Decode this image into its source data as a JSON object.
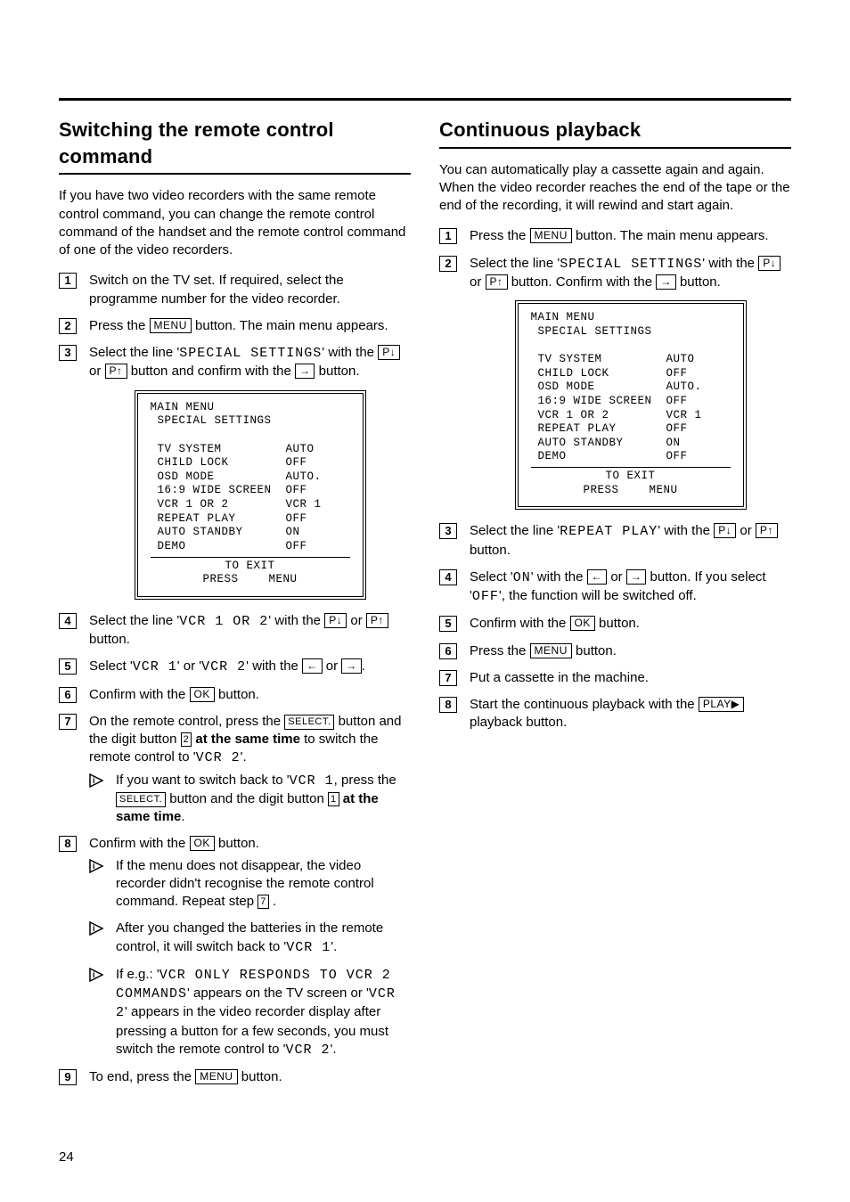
{
  "page_number": "24",
  "left": {
    "title": "Switching the remote control command",
    "intro": "If you have two video recorders with the same remote control command, you can change the remote control command of the handset and the remote control command of one of the video recorders.",
    "steps": {
      "s1": "Switch on the TV set. If required, select the programme number for the video recorder.",
      "s2a": "Press the ",
      "s2b": " button. The main menu appears.",
      "s3a": "Select the line '",
      "s3b": "' with the ",
      "s3c": " or ",
      "s3d": " button and confirm with the ",
      "s3e": " button.",
      "s4a": "Select the line '",
      "s4b": "' with the ",
      "s4c": " or ",
      "s4d": " button.",
      "s5a": "Select '",
      "s5b": "' or '",
      "s5c": "' with the ",
      "s5d": " or ",
      "s5e": ".",
      "s6a": "Confirm with the ",
      "s6b": " button.",
      "s7a": "On the remote control, press the ",
      "s7b": " button and the digit button ",
      "s7c": " at the same time",
      "s7d": " to switch the remote control to '",
      "s7e": "'.",
      "s7_tip1a": "If you want to switch back to '",
      "s7_tip1b": ", press the ",
      "s7_tip1c": " button and the digit button ",
      "s7_tip1d": " at the same time",
      "s7_tip1e": ".",
      "s8a": "Confirm with the ",
      "s8b": " button.",
      "s8_tip1a": "If the menu does not disappear, the video recorder didn't recognise the remote control command. Repeat step ",
      "s8_tip1b": " .",
      "s8_tip2a": "After you changed the batteries in the remote control, it will switch back to '",
      "s8_tip2b": "'.",
      "s8_tip3a": "If e.g.: '",
      "s8_tip3b": "' appears on the TV screen or '",
      "s8_tip3c": "' appears in the video recorder display after pressing a button for a few seconds, you must switch the remote control to '",
      "s8_tip3d": "'.",
      "s9a": "To end, press the ",
      "s9b": " button."
    },
    "mono": {
      "special_settings": "SPECIAL SETTINGS",
      "vcr1or2": "VCR 1 OR 2",
      "vcr1": "VCR 1",
      "vcr2": "VCR 2",
      "vcr_only": "VCR ONLY RESPONDS TO VCR 2 COMMANDS"
    },
    "keys": {
      "menu": "MENU",
      "pdown": "P↓",
      "pup": "P↑",
      "right": "→",
      "left": "←",
      "ok": "OK",
      "select": "SELECT.",
      "d2": "2",
      "d1": "1",
      "d7": "7"
    },
    "osd": {
      "title": "MAIN MENU",
      "subtitle": " SPECIAL SETTINGS",
      "rows": [
        {
          "l": "TV SYSTEM",
          "r": "AUTO"
        },
        {
          "l": "CHILD LOCK",
          "r": "OFF"
        },
        {
          "l": "OSD MODE",
          "r": "AUTO."
        },
        {
          "l": "16:9 WIDE SCREEN",
          "r": "OFF"
        },
        {
          "l": "VCR 1 OR 2",
          "r": "VCR 1"
        },
        {
          "l": "REPEAT PLAY",
          "r": "OFF"
        },
        {
          "l": "AUTO STANDBY",
          "r": "ON"
        },
        {
          "l": "DEMO",
          "r": "OFF"
        }
      ],
      "exit": "TO EXIT",
      "press": "PRESS",
      "menu": "MENU"
    }
  },
  "right": {
    "title": "Continuous playback",
    "intro": "You can automatically play a cassette again and again. When the video recorder reaches the end of the tape or the end of the recording, it will rewind and start again.",
    "steps": {
      "s1a": "Press the ",
      "s1b": " button. The main menu appears.",
      "s2a": "Select the line '",
      "s2b": "' with the ",
      "s2c": " or ",
      "s2d": " button. Confirm with the ",
      "s2e": " button.",
      "s3a": "Select the line '",
      "s3b": "' with the ",
      "s3c": " or ",
      "s3d": " button.",
      "s4a": "Select '",
      "s4b": "' with the ",
      "s4c": " or ",
      "s4d": " button. If you select '",
      "s4e": "', the function will be switched off.",
      "s5a": "Confirm with the ",
      "s5b": " button.",
      "s6a": "Press the ",
      "s6b": " button.",
      "s7": "Put a cassette in the machine.",
      "s8a": "Start the continuous playback with the ",
      "s8b": " playback button."
    },
    "mono": {
      "special_settings": "SPECIAL SETTINGS",
      "repeat_play": "REPEAT PLAY",
      "on": "ON",
      "off": "OFF"
    },
    "keys": {
      "menu": "MENU",
      "pdown": "P↓",
      "pup": "P↑",
      "right": "→",
      "left": "←",
      "ok": "OK",
      "play": "PLAY▶"
    },
    "osd": {
      "title": "MAIN MENU",
      "subtitle": " SPECIAL SETTINGS",
      "rows": [
        {
          "l": "TV SYSTEM",
          "r": "AUTO"
        },
        {
          "l": "CHILD LOCK",
          "r": "OFF"
        },
        {
          "l": "OSD MODE",
          "r": "AUTO."
        },
        {
          "l": "16:9 WIDE SCREEN",
          "r": "OFF"
        },
        {
          "l": "VCR 1 OR 2",
          "r": "VCR 1"
        },
        {
          "l": "REPEAT PLAY",
          "r": "OFF"
        },
        {
          "l": "AUTO STANDBY",
          "r": "ON"
        },
        {
          "l": "DEMO",
          "r": "OFF"
        }
      ],
      "exit": "TO EXIT",
      "press": "PRESS",
      "menu": "MENU"
    }
  }
}
